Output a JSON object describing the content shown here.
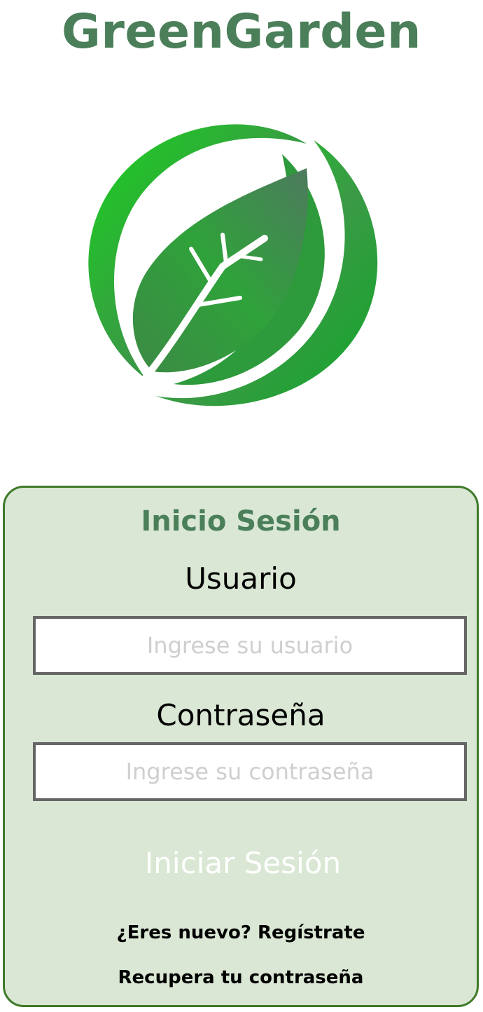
{
  "app": {
    "title": "GreenGarden",
    "logo_icon": "leaf-globe-logo"
  },
  "colors": {
    "brand_green": "#4a7f5a",
    "card_background": "#d9e7d4",
    "card_border": "#3f7a2a",
    "logo_green": "#2ea43a"
  },
  "login": {
    "title": "Inicio Sesión",
    "username_label": "Usuario",
    "username_placeholder": "Ingrese su usuario",
    "username_value": "",
    "password_label": "Contraseña",
    "password_placeholder": "Ingrese su contraseña",
    "password_value": "",
    "submit_label": "Iniciar Sesión",
    "register_link": "¿Eres nuevo? Regístrate",
    "recover_link": "Recupera tu contraseña"
  }
}
